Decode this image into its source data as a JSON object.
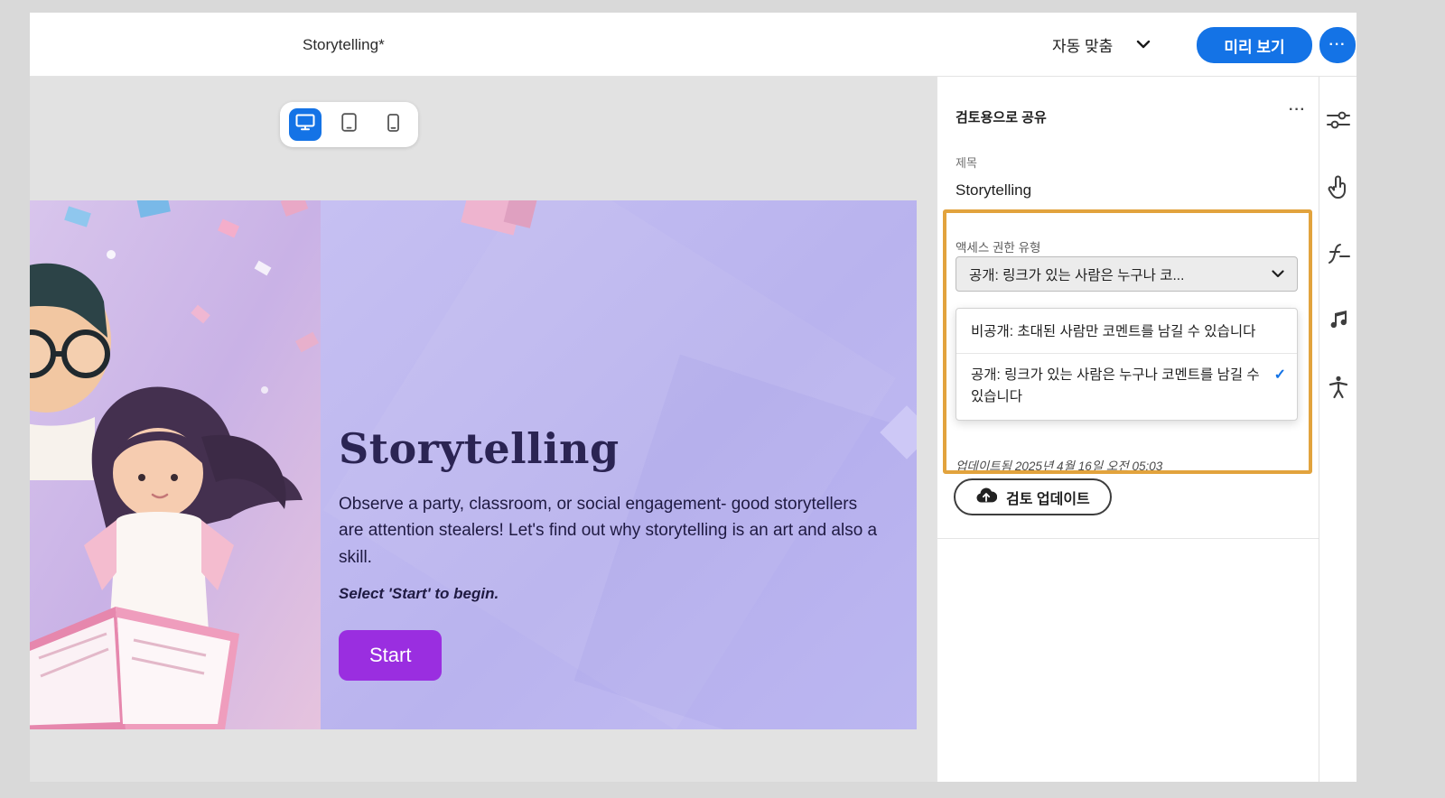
{
  "top_bar": {
    "doc_title": "Storytelling*",
    "fit_label": "자동 맞춤",
    "preview_label": "미리 보기",
    "more_label": "···"
  },
  "device_toggle": {
    "selected": "desktop",
    "devices": [
      "desktop",
      "tablet",
      "phone"
    ]
  },
  "slide": {
    "title": "Storytelling",
    "body": "Observe a party, classroom, or social engagement- good storytellers are attention stealers! Let's find out why storytelling is an art and also a skill.",
    "hint": "Select 'Start' to begin.",
    "start_label": "Start"
  },
  "share_panel": {
    "title": "검토용으로 공유",
    "more_label": "···",
    "name_label": "제목",
    "name_value": "Storytelling",
    "access_label": "액세스 권한 유형",
    "access_selected": "공개: 링크가 있는 사람은 누구나 코...",
    "options": [
      {
        "label": "비공개: 초대된 사람만 코멘트를 남길 수 있습니다",
        "selected": false
      },
      {
        "label": "공개: 링크가 있는 사람은 누구나 코멘트를 남길 수 있습니다",
        "selected": true
      }
    ],
    "check_glyph": "✓",
    "updated_text": "업데이트됨 2025년 4월 16일 오전 05:03",
    "update_button": "검토 업데이트"
  },
  "right_rail": {
    "icons": [
      "slide-properties",
      "interactions",
      "quick-actions",
      "audio",
      "accessibility"
    ]
  },
  "colors": {
    "accent_blue": "#1473E6",
    "highlight_orange": "#E2A33D",
    "start_purple": "#9A2EE0"
  }
}
